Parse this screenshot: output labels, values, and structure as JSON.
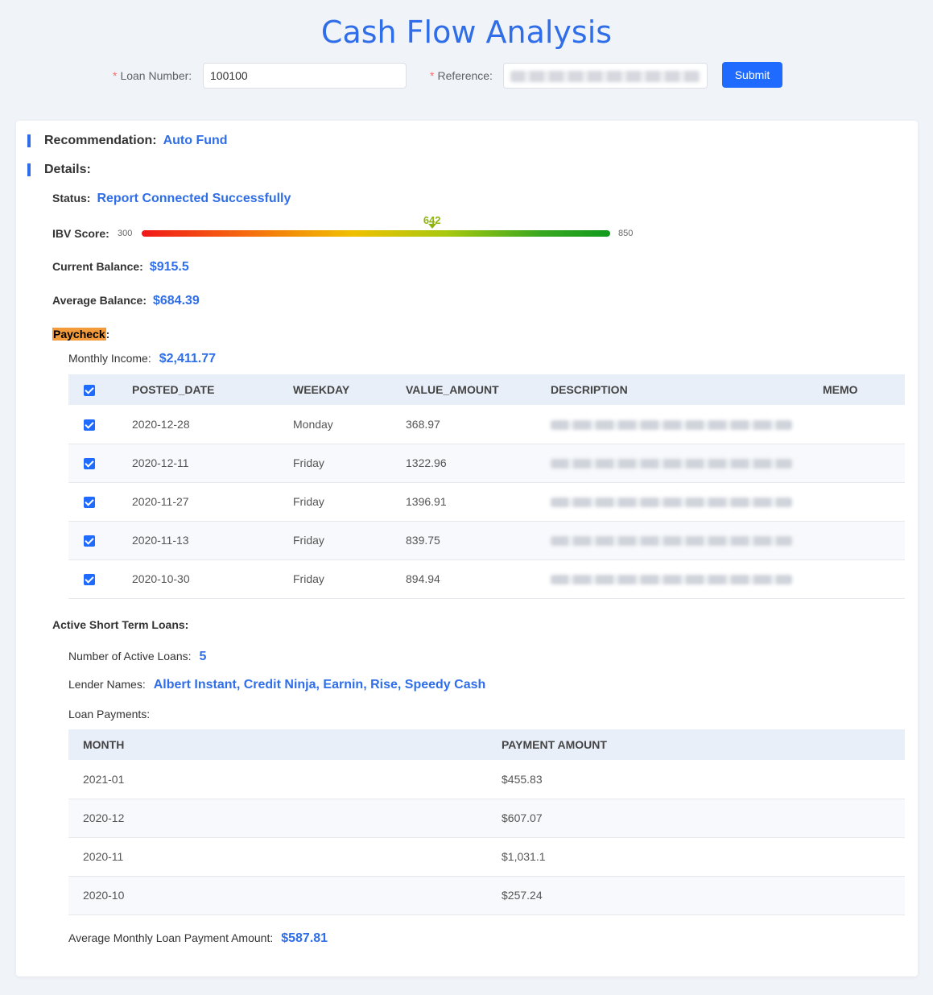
{
  "page": {
    "title": "Cash Flow Analysis"
  },
  "search": {
    "loan_number_label": "Loan Number:",
    "loan_number_value": "100100",
    "reference_label": "Reference:",
    "required_mark": "*",
    "submit_label": "Submit"
  },
  "recommendation": {
    "label": "Recommendation:",
    "value": "Auto Fund"
  },
  "details": {
    "label": "Details:",
    "status_label": "Status:",
    "status_value": "Report Connected Successfully",
    "ibv_label": "IBV Score:",
    "ibv_min": "300",
    "ibv_max": "850",
    "ibv_score": "642",
    "ibv_fraction": 0.62,
    "current_balance_label": "Current Balance:",
    "current_balance_value": "$915.5",
    "average_balance_label": "Average Balance:",
    "average_balance_value": "$684.39"
  },
  "paycheck": {
    "label": "Paycheck",
    "colon": ":",
    "monthly_income_label": "Monthly Income:",
    "monthly_income_value": "$2,411.77",
    "columns": [
      "POSTED_DATE",
      "WEEKDAY",
      "VALUE_AMOUNT",
      "DESCRIPTION",
      "MEMO"
    ],
    "rows": [
      {
        "date": "2020-12-28",
        "weekday": "Monday",
        "amount": "368.97"
      },
      {
        "date": "2020-12-11",
        "weekday": "Friday",
        "amount": "1322.96"
      },
      {
        "date": "2020-11-27",
        "weekday": "Friday",
        "amount": "1396.91"
      },
      {
        "date": "2020-11-13",
        "weekday": "Friday",
        "amount": "839.75"
      },
      {
        "date": "2020-10-30",
        "weekday": "Friday",
        "amount": "894.94"
      }
    ]
  },
  "loans": {
    "label": "Active Short Term Loans:",
    "active_count_label": "Number of Active Loans:",
    "active_count_value": "5",
    "lender_names_label": "Lender Names:",
    "lender_names_value": "Albert Instant, Credit Ninja, Earnin, Rise, Speedy Cash",
    "payments_label": "Loan Payments:",
    "columns": [
      "MONTH",
      "PAYMENT AMOUNT"
    ],
    "rows": [
      {
        "month": "2021-01",
        "amount": "$455.83"
      },
      {
        "month": "2020-12",
        "amount": "$607.07"
      },
      {
        "month": "2020-11",
        "amount": "$1,031.1"
      },
      {
        "month": "2020-10",
        "amount": "$257.24"
      }
    ],
    "average_label": "Average Monthly Loan Payment Amount:",
    "average_value": "$587.81"
  },
  "colors": {
    "accent": "#2f6ee8",
    "button": "#1f6bff",
    "highlight": "#f39a3b",
    "score": "#8db40c"
  }
}
